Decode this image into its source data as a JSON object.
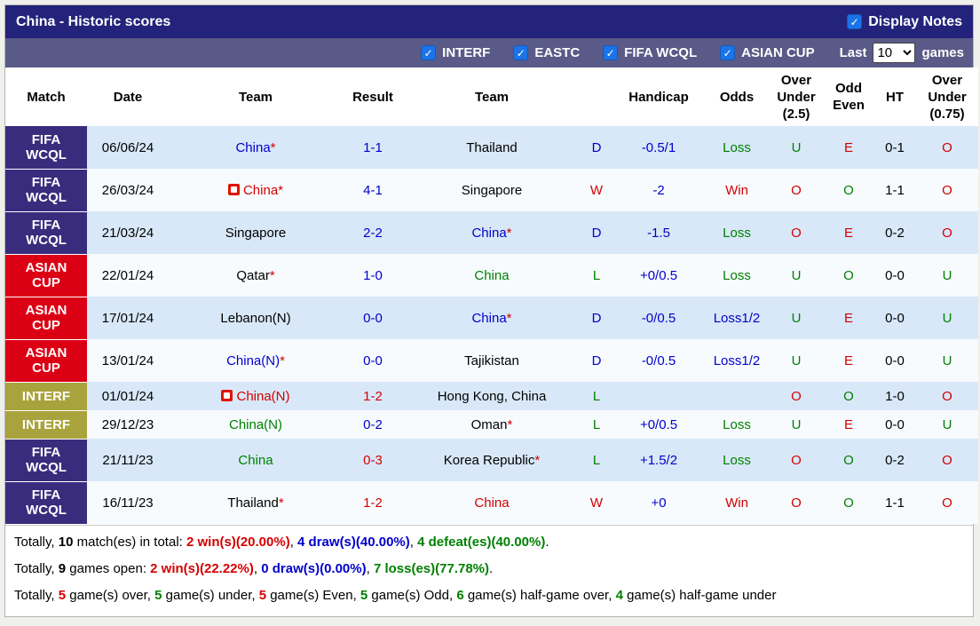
{
  "colors": {
    "title_bg": "#23237b",
    "filter_bg": "#5a5a88",
    "fifa_bg": "#3a2c7d",
    "asian_bg": "#dc0014",
    "interf_bg": "#a8a33c",
    "row_alt": "#d8e8f8",
    "row_light": "#f7fbfe",
    "checkbox": "#1a73e8",
    "blue": "#0000cc",
    "red": "#d40000",
    "green": "#008000"
  },
  "title_bar": {
    "title": "China - Historic scores",
    "display_notes": "Display Notes",
    "display_notes_checked": true
  },
  "filter_bar": {
    "filters": [
      "INTERF",
      "EASTC",
      "FIFA WCQL",
      "ASIAN CUP"
    ],
    "filters_checked": [
      true,
      true,
      true,
      true
    ],
    "last_label": "Last",
    "games_value": "10",
    "games_label": "games"
  },
  "table": {
    "headers": [
      "Match",
      "Date",
      "Team",
      "Result",
      "Team",
      "",
      "Handicap",
      "Odds",
      "Over Under (2.5)",
      "Odd Even",
      "HT",
      "Over Under (0.75)"
    ],
    "rows": [
      {
        "competition": "FIFA WCQL",
        "comp_class": "fifa",
        "date": "06/06/24",
        "home": {
          "name": "China",
          "star": true,
          "color": "blue",
          "icon": false
        },
        "result": "1-1",
        "result_color": "blue",
        "away": {
          "name": "Thailand",
          "star": false,
          "color": "black",
          "icon": false
        },
        "outcome": "D",
        "outcome_color": "blue",
        "handicap": "-0.5/1",
        "odds": "Loss",
        "odds_color": "green",
        "ou25": "U",
        "ou25_color": "green",
        "odd_even": "E",
        "odd_even_color": "red",
        "ht": "0-1",
        "ou075": "O",
        "ou075_color": "red"
      },
      {
        "competition": "FIFA WCQL",
        "comp_class": "fifa",
        "date": "26/03/24",
        "home": {
          "name": "China",
          "star": true,
          "color": "red",
          "icon": true
        },
        "result": "4-1",
        "result_color": "blue",
        "away": {
          "name": "Singapore",
          "star": false,
          "color": "black",
          "icon": false
        },
        "outcome": "W",
        "outcome_color": "red",
        "handicap": "-2",
        "odds": "Win",
        "odds_color": "red",
        "ou25": "O",
        "ou25_color": "red",
        "odd_even": "O",
        "odd_even_color": "green",
        "ht": "1-1",
        "ou075": "O",
        "ou075_color": "red"
      },
      {
        "competition": "FIFA WCQL",
        "comp_class": "fifa",
        "date": "21/03/24",
        "home": {
          "name": "Singapore",
          "star": false,
          "color": "black",
          "icon": false
        },
        "result": "2-2",
        "result_color": "blue",
        "away": {
          "name": "China",
          "star": true,
          "color": "blue",
          "icon": false
        },
        "outcome": "D",
        "outcome_color": "blue",
        "handicap": "-1.5",
        "odds": "Loss",
        "odds_color": "green",
        "ou25": "O",
        "ou25_color": "red",
        "odd_even": "E",
        "odd_even_color": "red",
        "ht": "0-2",
        "ou075": "O",
        "ou075_color": "red"
      },
      {
        "competition": "ASIAN CUP",
        "comp_class": "asian",
        "date": "22/01/24",
        "home": {
          "name": "Qatar",
          "star": true,
          "color": "black",
          "icon": false
        },
        "result": "1-0",
        "result_color": "blue",
        "away": {
          "name": "China",
          "star": false,
          "color": "green",
          "icon": false
        },
        "outcome": "L",
        "outcome_color": "green",
        "handicap": "+0/0.5",
        "odds": "Loss",
        "odds_color": "green",
        "ou25": "U",
        "ou25_color": "green",
        "odd_even": "O",
        "odd_even_color": "green",
        "ht": "0-0",
        "ou075": "U",
        "ou075_color": "green"
      },
      {
        "competition": "ASIAN CUP",
        "comp_class": "asian",
        "date": "17/01/24",
        "home": {
          "name": "Lebanon(N)",
          "star": false,
          "color": "black",
          "icon": false
        },
        "result": "0-0",
        "result_color": "blue",
        "away": {
          "name": "China",
          "star": true,
          "color": "blue",
          "icon": false
        },
        "outcome": "D",
        "outcome_color": "blue",
        "handicap": "-0/0.5",
        "odds": "Loss1/2",
        "odds_color": "blue",
        "ou25": "U",
        "ou25_color": "green",
        "odd_even": "E",
        "odd_even_color": "red",
        "ht": "0-0",
        "ou075": "U",
        "ou075_color": "green"
      },
      {
        "competition": "ASIAN CUP",
        "comp_class": "asian",
        "date": "13/01/24",
        "home": {
          "name": "China(N)",
          "star": true,
          "color": "blue",
          "icon": false
        },
        "result": "0-0",
        "result_color": "blue",
        "away": {
          "name": "Tajikistan",
          "star": false,
          "color": "black",
          "icon": false
        },
        "outcome": "D",
        "outcome_color": "blue",
        "handicap": "-0/0.5",
        "odds": "Loss1/2",
        "odds_color": "blue",
        "ou25": "U",
        "ou25_color": "green",
        "odd_even": "E",
        "odd_even_color": "red",
        "ht": "0-0",
        "ou075": "U",
        "ou075_color": "green"
      },
      {
        "competition": "INTERF",
        "comp_class": "interf",
        "date": "01/01/24",
        "home": {
          "name": "China(N)",
          "star": false,
          "color": "red",
          "icon": true
        },
        "result": "1-2",
        "result_color": "red",
        "away": {
          "name": "Hong Kong, China",
          "star": false,
          "color": "black",
          "icon": false
        },
        "outcome": "L",
        "outcome_color": "green",
        "handicap": "",
        "odds": "",
        "odds_color": "black",
        "ou25": "O",
        "ou25_color": "red",
        "odd_even": "O",
        "odd_even_color": "green",
        "ht": "1-0",
        "ou075": "O",
        "ou075_color": "red"
      },
      {
        "competition": "INTERF",
        "comp_class": "interf",
        "date": "29/12/23",
        "home": {
          "name": "China(N)",
          "star": false,
          "color": "green",
          "icon": false
        },
        "result": "0-2",
        "result_color": "blue",
        "away": {
          "name": "Oman",
          "star": true,
          "color": "black",
          "icon": false
        },
        "outcome": "L",
        "outcome_color": "green",
        "handicap": "+0/0.5",
        "odds": "Loss",
        "odds_color": "green",
        "ou25": "U",
        "ou25_color": "green",
        "odd_even": "E",
        "odd_even_color": "red",
        "ht": "0-0",
        "ou075": "U",
        "ou075_color": "green"
      },
      {
        "competition": "FIFA WCQL",
        "comp_class": "fifa",
        "date": "21/11/23",
        "home": {
          "name": "China",
          "star": false,
          "color": "green",
          "icon": false
        },
        "result": "0-3",
        "result_color": "red",
        "away": {
          "name": "Korea Republic",
          "star": true,
          "color": "black",
          "icon": false
        },
        "outcome": "L",
        "outcome_color": "green",
        "handicap": "+1.5/2",
        "odds": "Loss",
        "odds_color": "green",
        "ou25": "O",
        "ou25_color": "red",
        "odd_even": "O",
        "odd_even_color": "green",
        "ht": "0-2",
        "ou075": "O",
        "ou075_color": "red"
      },
      {
        "competition": "FIFA WCQL",
        "comp_class": "fifa",
        "date": "16/11/23",
        "home": {
          "name": "Thailand",
          "star": true,
          "color": "black",
          "icon": false
        },
        "result": "1-2",
        "result_color": "red",
        "away": {
          "name": "China",
          "star": false,
          "color": "red",
          "icon": false
        },
        "outcome": "W",
        "outcome_color": "red",
        "handicap": "+0",
        "odds": "Win",
        "odds_color": "red",
        "ou25": "O",
        "ou25_color": "red",
        "odd_even": "O",
        "odd_even_color": "green",
        "ht": "1-1",
        "ou075": "O",
        "ou075_color": "red"
      }
    ]
  },
  "summary": {
    "lines": [
      [
        {
          "text": "Totally, ",
          "color": "black",
          "bold": false
        },
        {
          "text": "10",
          "color": "black",
          "bold": true
        },
        {
          "text": " match(es) in total: ",
          "color": "black",
          "bold": false
        },
        {
          "text": "2 win(s)(20.00%)",
          "color": "red",
          "bold": true
        },
        {
          "text": ", ",
          "color": "black",
          "bold": false
        },
        {
          "text": "4 draw(s)(40.00%)",
          "color": "blue",
          "bold": true
        },
        {
          "text": ", ",
          "color": "black",
          "bold": false
        },
        {
          "text": "4 defeat(es)(40.00%)",
          "color": "green",
          "bold": true
        },
        {
          "text": ".",
          "color": "black",
          "bold": false
        }
      ],
      [
        {
          "text": "Totally, ",
          "color": "black",
          "bold": false
        },
        {
          "text": "9",
          "color": "black",
          "bold": true
        },
        {
          "text": " games open: ",
          "color": "black",
          "bold": false
        },
        {
          "text": "2 win(s)(22.22%)",
          "color": "red",
          "bold": true
        },
        {
          "text": ", ",
          "color": "black",
          "bold": false
        },
        {
          "text": "0 draw(s)(0.00%)",
          "color": "blue",
          "bold": true
        },
        {
          "text": ", ",
          "color": "black",
          "bold": false
        },
        {
          "text": "7 loss(es)(77.78%)",
          "color": "green",
          "bold": true
        },
        {
          "text": ".",
          "color": "black",
          "bold": false
        }
      ],
      [
        {
          "text": "Totally, ",
          "color": "black",
          "bold": false
        },
        {
          "text": "5",
          "color": "red",
          "bold": true
        },
        {
          "text": " game(s) over, ",
          "color": "black",
          "bold": false
        },
        {
          "text": "5",
          "color": "green",
          "bold": true
        },
        {
          "text": " game(s) under, ",
          "color": "black",
          "bold": false
        },
        {
          "text": "5",
          "color": "red",
          "bold": true
        },
        {
          "text": " game(s) Even, ",
          "color": "black",
          "bold": false
        },
        {
          "text": "5",
          "color": "green",
          "bold": true
        },
        {
          "text": " game(s) Odd, ",
          "color": "black",
          "bold": false
        },
        {
          "text": "6",
          "color": "green",
          "bold": true
        },
        {
          "text": " game(s) half-game over, ",
          "color": "black",
          "bold": false
        },
        {
          "text": "4",
          "color": "green",
          "bold": true
        },
        {
          "text": " game(s) half-game under",
          "color": "black",
          "bold": false
        }
      ]
    ]
  }
}
